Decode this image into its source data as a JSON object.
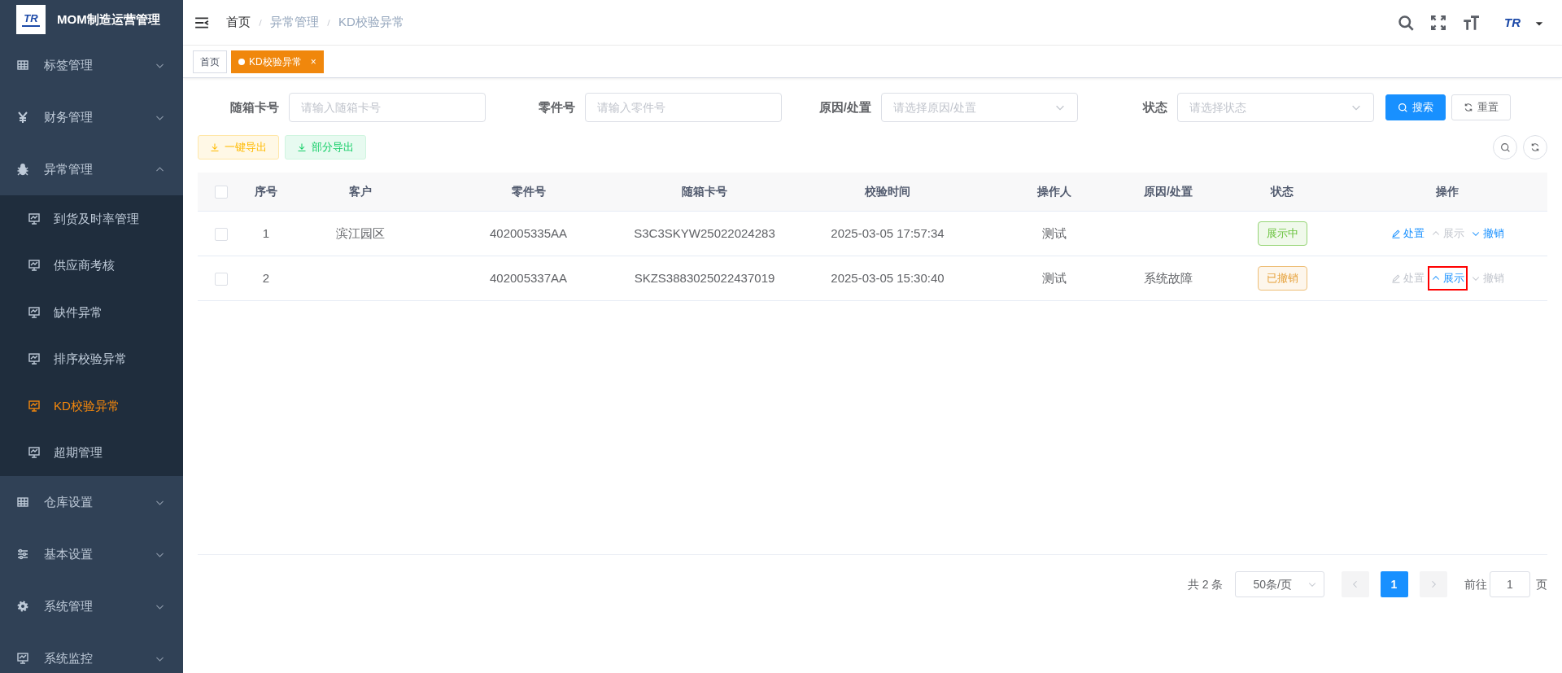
{
  "sidebar": {
    "logo_text": "TR",
    "title": "MOM制造运营管理",
    "items": [
      {
        "label": "标签管理",
        "kind": "grid",
        "expanded": false
      },
      {
        "label": "财务管理",
        "kind": "yen",
        "expanded": false
      },
      {
        "label": "异常管理",
        "kind": "bug",
        "expanded": true,
        "children": [
          {
            "label": "到货及时率管理",
            "selected": false
          },
          {
            "label": "供应商考核",
            "selected": false
          },
          {
            "label": "缺件异常",
            "selected": false
          },
          {
            "label": "排序校验异常",
            "selected": false
          },
          {
            "label": "KD校验异常",
            "selected": true
          },
          {
            "label": "超期管理",
            "selected": false
          }
        ]
      },
      {
        "label": "仓库设置",
        "kind": "grid",
        "expanded": false
      },
      {
        "label": "基本设置",
        "kind": "sliders",
        "expanded": false
      },
      {
        "label": "系统管理",
        "kind": "gear",
        "expanded": false
      },
      {
        "label": "系统监控",
        "kind": "monitor",
        "expanded": false
      }
    ]
  },
  "header": {
    "breadcrumb": [
      "首页",
      "异常管理",
      "KD校验异常"
    ],
    "avatar_text": "TR"
  },
  "tabs": [
    {
      "label": "首页",
      "selected": false
    },
    {
      "label": "KD校验异常",
      "selected": true,
      "close": "×"
    }
  ],
  "filters": [
    {
      "label": "随箱卡号",
      "kind": "input",
      "placeholder": "请输入随箱卡号"
    },
    {
      "label": "零件号",
      "kind": "input",
      "placeholder": "请输入零件号"
    },
    {
      "label": "原因/处置",
      "kind": "select",
      "placeholder": "请选择原因/处置"
    },
    {
      "label": "状态",
      "kind": "select",
      "placeholder": "请选择状态"
    }
  ],
  "search_button": "搜索",
  "reset_button": "重置",
  "export_buttons": [
    {
      "label": "一键导出",
      "kind": "warning"
    },
    {
      "label": "部分导出",
      "kind": "success"
    }
  ],
  "table": {
    "select_all_checked": false,
    "columns": [
      "序号",
      "客户",
      "零件号",
      "随箱卡号",
      "校验时间",
      "操作人",
      "原因/处置",
      "状态",
      "操作"
    ],
    "rows": [
      {
        "checked": false,
        "cells": [
          "1",
          "滨江园区",
          "402005335AA",
          "S3C3SKYW25022024283",
          "2025-03-05 17:57:34",
          "测试",
          ""
        ],
        "status": {
          "text": "展示中",
          "kind": "success"
        },
        "actions": [
          {
            "label": "处置",
            "kind": "edit",
            "disabled": false,
            "highlighted": false
          },
          {
            "label": "展示",
            "kind": "up",
            "disabled": true,
            "highlighted": false
          },
          {
            "label": "撤销",
            "kind": "down",
            "disabled": false,
            "highlighted": false
          }
        ]
      },
      {
        "checked": false,
        "cells": [
          "2",
          "",
          "402005337AA",
          "SKZS3883025022437019",
          "2025-03-05 15:30:40",
          "测试",
          "系统故障"
        ],
        "status": {
          "text": "已撤销",
          "kind": "warning"
        },
        "actions": [
          {
            "label": "处置",
            "kind": "edit",
            "disabled": true,
            "highlighted": false
          },
          {
            "label": "展示",
            "kind": "up",
            "disabled": false,
            "highlighted": true
          },
          {
            "label": "撤销",
            "kind": "down",
            "disabled": true,
            "highlighted": false
          }
        ]
      }
    ]
  },
  "pagination": {
    "total": "共 2 条",
    "page_size": "50条/页",
    "pages": [
      {
        "label": "1",
        "selected": true
      }
    ],
    "goto_label": "前往",
    "goto_value": "1",
    "suffix": "页"
  }
}
